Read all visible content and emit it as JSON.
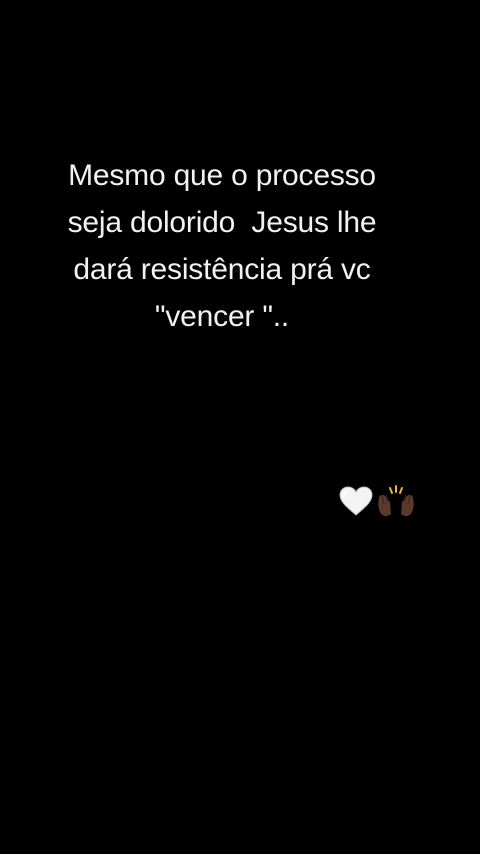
{
  "background_color": "#000000",
  "text_color": "#f2f2f2",
  "caption": {
    "lines": [
      "Mesmo que o processo",
      "seja dolorido  Jesus lhe",
      "dará resistência prá vc",
      "\"vencer \".."
    ]
  },
  "emojis": [
    "white-heart-icon",
    "raising-hands-icon"
  ]
}
